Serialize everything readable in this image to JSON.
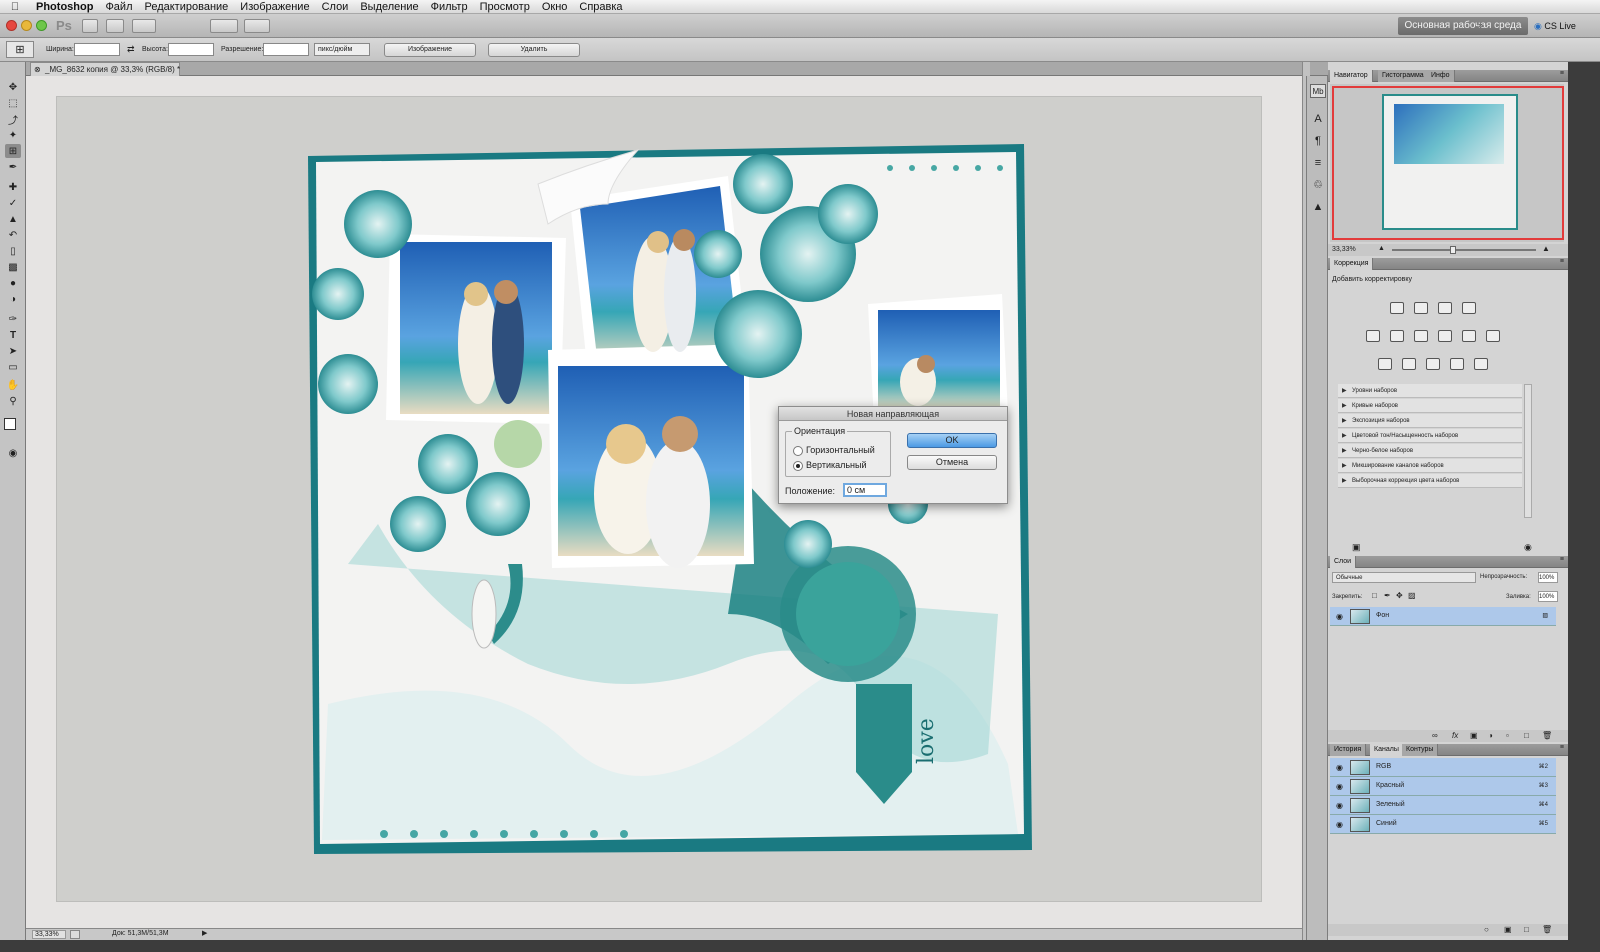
{
  "menubar": {
    "apple": "",
    "items": [
      "Photoshop",
      "Файл",
      "Редактирование",
      "Изображение",
      "Слои",
      "Выделение",
      "Фильтр",
      "Просмотр",
      "Окно",
      "Справка"
    ]
  },
  "appbar": {
    "ps_logo": "Ps",
    "workspace": "Основная рабочая среда",
    "cs_live": "CS Live"
  },
  "options": {
    "width_label": "Ширина:",
    "height_label": "Высота:",
    "resolution_label": "Разрешение:",
    "unit": "пикс/дюйм",
    "image_button": "Изображение",
    "delete_button": "Удалить"
  },
  "document": {
    "tab": "_MG_8632 копия @ 33,3% (RGB/8) *",
    "zoom": "33,33%",
    "doc_info": "Док: 51,3M/51,3M"
  },
  "navigator": {
    "tabs": [
      "Навигатор",
      "Гистограмма",
      "Инфо"
    ],
    "zoom": "33,33%"
  },
  "adjustments": {
    "tab": "Коррекция",
    "title": "Добавить корректировку",
    "presets": [
      "Уровни наборов",
      "Кривые наборов",
      "Экспозиция наборов",
      "Цветовой тон/Насыщенность наборов",
      "Черно-белое наборов",
      "Микширование каналов наборов",
      "Выборочная коррекция цвета наборов"
    ]
  },
  "layers": {
    "tab": "Слои",
    "blend_mode": "Обычные",
    "opacity_label": "Непрозрачность:",
    "opacity": "100%",
    "lock_label": "Закрепить:",
    "fill_label": "Заливка:",
    "fill": "100%",
    "layer_name": "Фон"
  },
  "channels": {
    "tabs": [
      "История",
      "Каналы",
      "Контуры"
    ],
    "rows": [
      {
        "name": "RGB",
        "key": "⌘2"
      },
      {
        "name": "Красный",
        "key": "⌘3"
      },
      {
        "name": "Зеленый",
        "key": "⌘4"
      },
      {
        "name": "Синий",
        "key": "⌘5"
      }
    ]
  },
  "dialog": {
    "title": "Новая направляющая",
    "orientation_label": "Ориентация",
    "horizontal": "Горизонтальный",
    "vertical": "Вертикальный",
    "selected": "vertical",
    "position_label": "Положение:",
    "position_value": "0 см",
    "ok": "OK",
    "cancel": "Отмена"
  },
  "artwork": {
    "love_text": "love"
  },
  "colors": {
    "teal": "#1f7f86",
    "accent_blue": "#4b9ae4",
    "layer_highlight": "#adc8ea"
  }
}
